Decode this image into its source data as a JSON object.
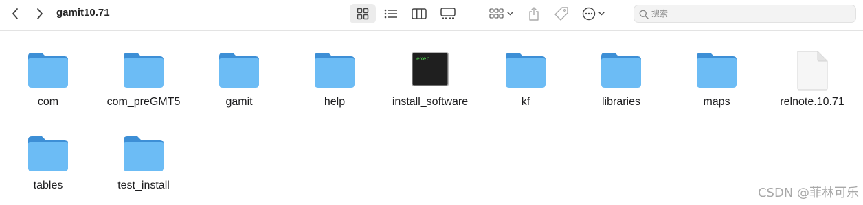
{
  "window": {
    "title": "gamit10.71"
  },
  "toolbar": {
    "back": "chevron-left-icon",
    "forward": "chevron-right-icon",
    "views": [
      "icon-view",
      "list-view",
      "column-view",
      "gallery-view"
    ],
    "active_view": "icon-view",
    "group": "group-icon",
    "share": "share-icon",
    "tag": "tag-icon",
    "more": "ellipsis-circle-icon"
  },
  "search": {
    "placeholder": "搜索",
    "value": ""
  },
  "items": [
    {
      "name": "com",
      "kind": "folder"
    },
    {
      "name": "com_preGMT5",
      "kind": "folder"
    },
    {
      "name": "gamit",
      "kind": "folder"
    },
    {
      "name": "help",
      "kind": "folder"
    },
    {
      "name": "install_software",
      "kind": "exec",
      "badge": "exec"
    },
    {
      "name": "kf",
      "kind": "folder"
    },
    {
      "name": "libraries",
      "kind": "folder"
    },
    {
      "name": "maps",
      "kind": "folder"
    },
    {
      "name": "relnote.10.71",
      "kind": "document"
    },
    {
      "name": "tables",
      "kind": "folder"
    },
    {
      "name": "test_install",
      "kind": "folder"
    }
  ],
  "colors": {
    "folder_body": "#6cbcf5",
    "folder_tab": "#3d8fd6",
    "terminal_bg": "#1f1f1f",
    "terminal_text": "#4fd14f"
  },
  "watermark": "CSDN @菲林可乐"
}
